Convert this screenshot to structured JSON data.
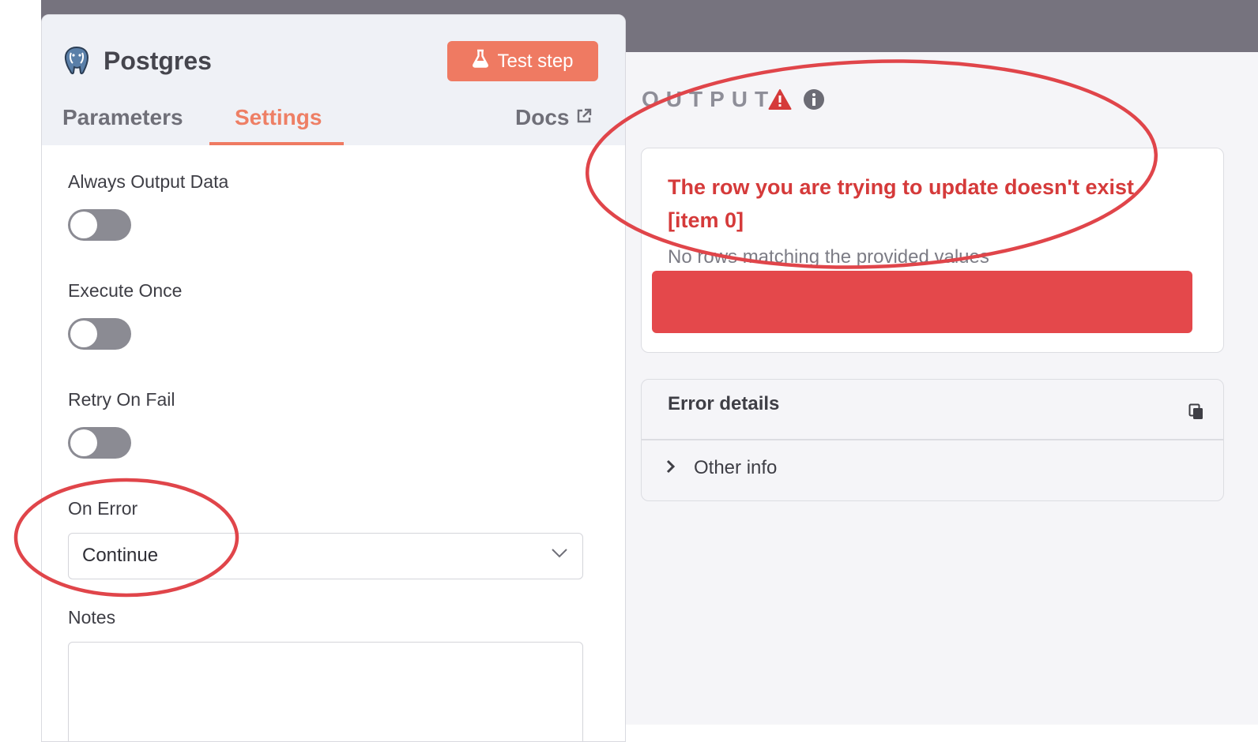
{
  "node": {
    "title": "Postgres",
    "test_step_label": "Test step",
    "tabs": [
      {
        "label": "Parameters"
      },
      {
        "label": "Settings"
      }
    ],
    "docs_label": "Docs"
  },
  "settings": {
    "always_output_data": {
      "label": "Always Output Data",
      "enabled": false
    },
    "execute_once": {
      "label": "Execute Once",
      "enabled": false
    },
    "retry_on_fail": {
      "label": "Retry On Fail",
      "enabled": false
    },
    "on_error": {
      "label": "On Error",
      "value": "Continue"
    },
    "notes": {
      "label": "Notes",
      "value": ""
    }
  },
  "output": {
    "heading": "OUTPUT",
    "error_title": "The row you are trying to update doesn't exist [item 0]",
    "error_description": "No rows matching the provided values",
    "error_details_title": "Error details",
    "other_info_label": "Other info"
  },
  "colors": {
    "accent": "#ef7a62",
    "error": "#d53a3a",
    "redaction": "#e4484b",
    "annotation": "#e0454a"
  },
  "icons": {
    "node": "postgres-elephant-icon",
    "test_step": "flask-icon",
    "docs": "external-link-icon",
    "warning": "warning-triangle-icon",
    "info": "info-circle-icon",
    "copy": "copy-icon",
    "expand": "chevron-right-icon",
    "select": "chevron-down-icon"
  }
}
